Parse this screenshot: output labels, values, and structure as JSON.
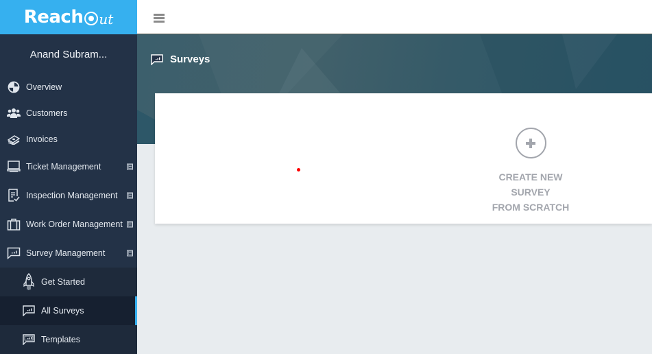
{
  "brand": {
    "name_bold": "Reach",
    "name_script": "ut",
    "color": "#36b0ef"
  },
  "user": {
    "display_name": "Anand Subram..."
  },
  "sidebar": {
    "items": [
      {
        "label": "Overview",
        "icon": "globe-icon",
        "expandable": false
      },
      {
        "label": "Customers",
        "icon": "users-icon",
        "expandable": false
      },
      {
        "label": "Invoices",
        "icon": "money-stack-icon",
        "expandable": false
      },
      {
        "label": "Ticket Management",
        "icon": "monitor-icon",
        "expandable": true,
        "state": "collapsed",
        "toggle": "⊞"
      },
      {
        "label": "Inspection Management",
        "icon": "checklist-icon",
        "expandable": true,
        "state": "collapsed",
        "toggle": "⊞"
      },
      {
        "label": "Work Order Management",
        "icon": "briefcase-icon",
        "expandable": true,
        "state": "collapsed",
        "toggle": "⊞"
      },
      {
        "label": "Survey Management",
        "icon": "survey-chat-icon",
        "expandable": true,
        "state": "expanded",
        "toggle": "⊟"
      }
    ],
    "survey_sub_items": [
      {
        "label": "Get Started",
        "icon": "rocket-icon",
        "active": false
      },
      {
        "label": "All Surveys",
        "icon": "survey-chat-icon",
        "active": true
      },
      {
        "label": "Templates",
        "icon": "templates-chat-icon",
        "active": false
      }
    ]
  },
  "topbar": {
    "menu_icon": "hamburger-icon"
  },
  "page": {
    "title": "Surveys",
    "title_icon": "survey-chat-icon"
  },
  "create_card": {
    "line1": "CREATE NEW SURVEY",
    "line2": "FROM SCRATCH",
    "icon": "plus-circle-icon"
  }
}
